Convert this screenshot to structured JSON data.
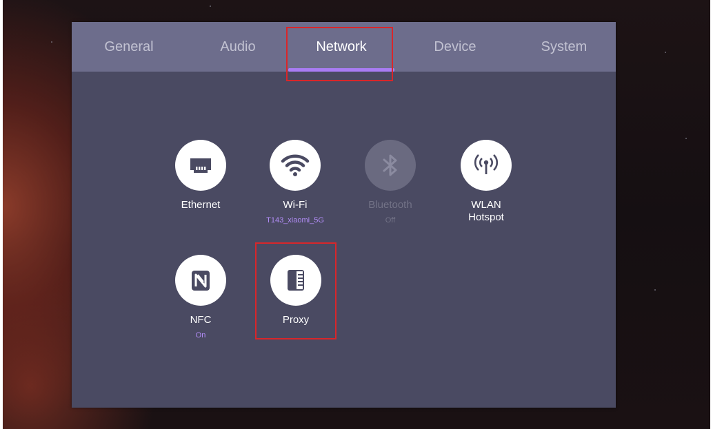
{
  "tabs": [
    {
      "label": "General",
      "active": false
    },
    {
      "label": "Audio",
      "active": false
    },
    {
      "label": "Network",
      "active": true
    },
    {
      "label": "Device",
      "active": false
    },
    {
      "label": "System",
      "active": false
    }
  ],
  "items": [
    {
      "label": "Ethernet",
      "status": "",
      "icon": "ethernet-icon",
      "enabled": true
    },
    {
      "label": "Wi-Fi",
      "status": "T143_xiaomi_5G",
      "icon": "wifi-icon",
      "enabled": true
    },
    {
      "label": "Bluetooth",
      "status": "Off",
      "icon": "bluetooth-icon",
      "enabled": false
    },
    {
      "label": "WLAN Hotspot",
      "status": "",
      "icon": "hotspot-icon",
      "enabled": true
    },
    {
      "label": "NFC",
      "status": "On",
      "icon": "nfc-icon",
      "enabled": true
    },
    {
      "label": "Proxy",
      "status": "",
      "icon": "proxy-icon",
      "enabled": true
    }
  ],
  "colors": {
    "accent": "#a97cf4",
    "panel": "#4a4a62",
    "tabbar": "#6d6d8c",
    "highlight": "#d9262a"
  }
}
